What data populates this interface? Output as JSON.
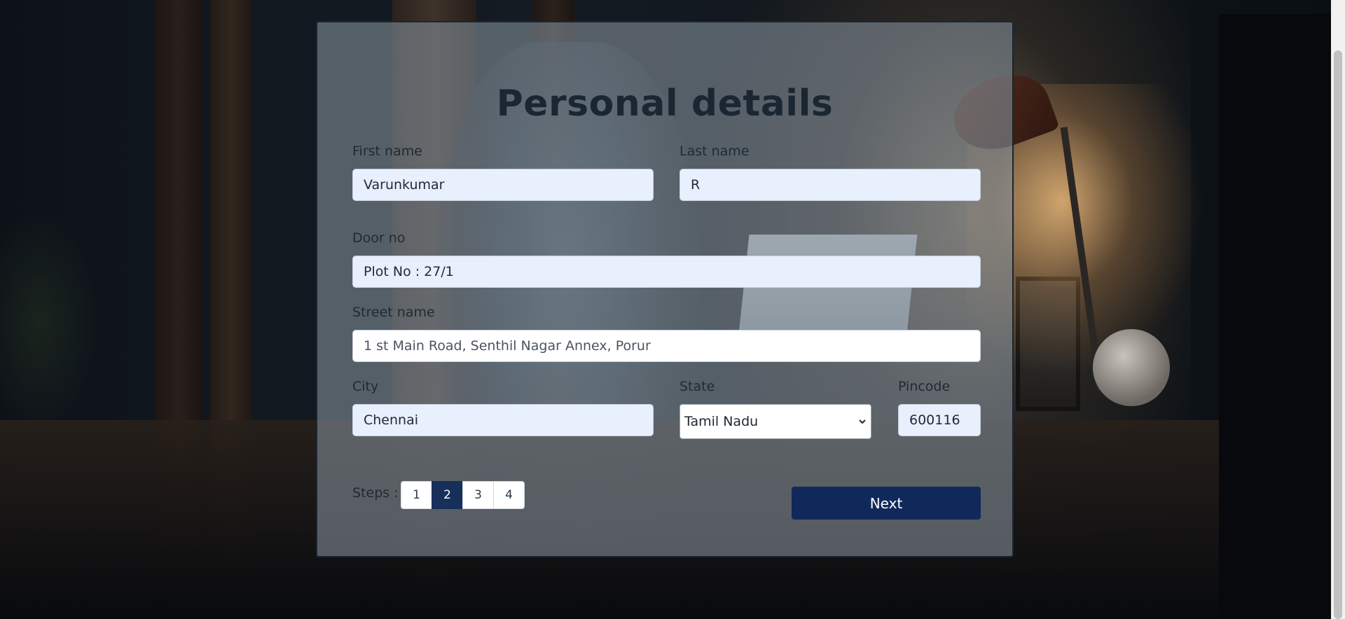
{
  "form": {
    "title": "Personal details",
    "first_name": {
      "label": "First name",
      "value": "Varunkumar"
    },
    "last_name": {
      "label": "Last name",
      "value": "R"
    },
    "door_no": {
      "label": "Door no",
      "value": "Plot No : 27/1"
    },
    "street_name": {
      "label": "Street name",
      "value": "1 st Main Road, Senthil Nagar Annex, Porur"
    },
    "city": {
      "label": "City",
      "value": "Chennai"
    },
    "state": {
      "label": "State",
      "value": "Tamil Nadu"
    },
    "pincode": {
      "label": "Pincode",
      "value": "600116"
    },
    "steps": {
      "label": "Steps :",
      "pages": [
        "1",
        "2",
        "3",
        "4"
      ],
      "current": "2"
    },
    "next_label": "Next"
  },
  "colors": {
    "accent": "#11295a",
    "field_bg": "#e8effd",
    "title": "#1b2633"
  }
}
